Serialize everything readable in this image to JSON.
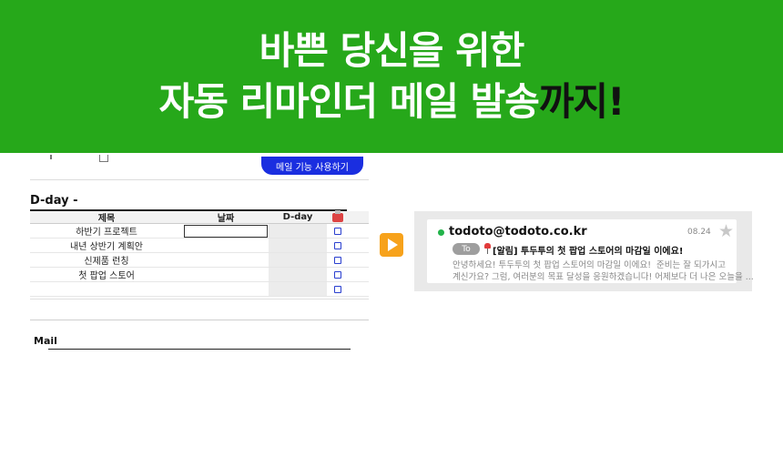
{
  "banner": {
    "line1": "바쁜 당신을 위한",
    "line2_main": "자동 리마인더 메일 발송",
    "line2_accent": "까지!"
  },
  "sheet": {
    "mail_button_label": "메일 기능 사용하기",
    "dday_title": "D-day -",
    "columns": [
      "제목",
      "날짜",
      "D-day"
    ],
    "rows": [
      {
        "title": "하반기 프로젝트"
      },
      {
        "title": "내년 상반기 계획안"
      },
      {
        "title": "신제품 런칭"
      },
      {
        "title": "첫 팝업 스토어"
      },
      {
        "title": ""
      }
    ],
    "mail_section_title": "Mail"
  },
  "email": {
    "sender": "todoto@todoto.co.kr",
    "date": "08.24",
    "to_label": "To",
    "subject": "[알림] 투두투의 첫 팝업 스토어의 마감일 이에요!",
    "preview_line1": "안녕하세요! 투두투의 첫 팝업 스토어의 마감일 이에요!",
    "preview_line1b": "준비는 잘 되가시고",
    "preview_line2": "계신가요? 그럼, 여러분의 목표 달성을 응원하겠습니다! 어제보다 더 나은 오늘을 ..."
  },
  "colors": {
    "banner_bg": "#26a81a",
    "button_blue": "#1a2ee0",
    "arrow_orange": "#f7a21b",
    "sender_dot": "#22b34a"
  },
  "icons": [
    "play-arrow-icon",
    "star-icon",
    "pushpin-icon",
    "mail-header-icon",
    "checkbox-icon"
  ]
}
